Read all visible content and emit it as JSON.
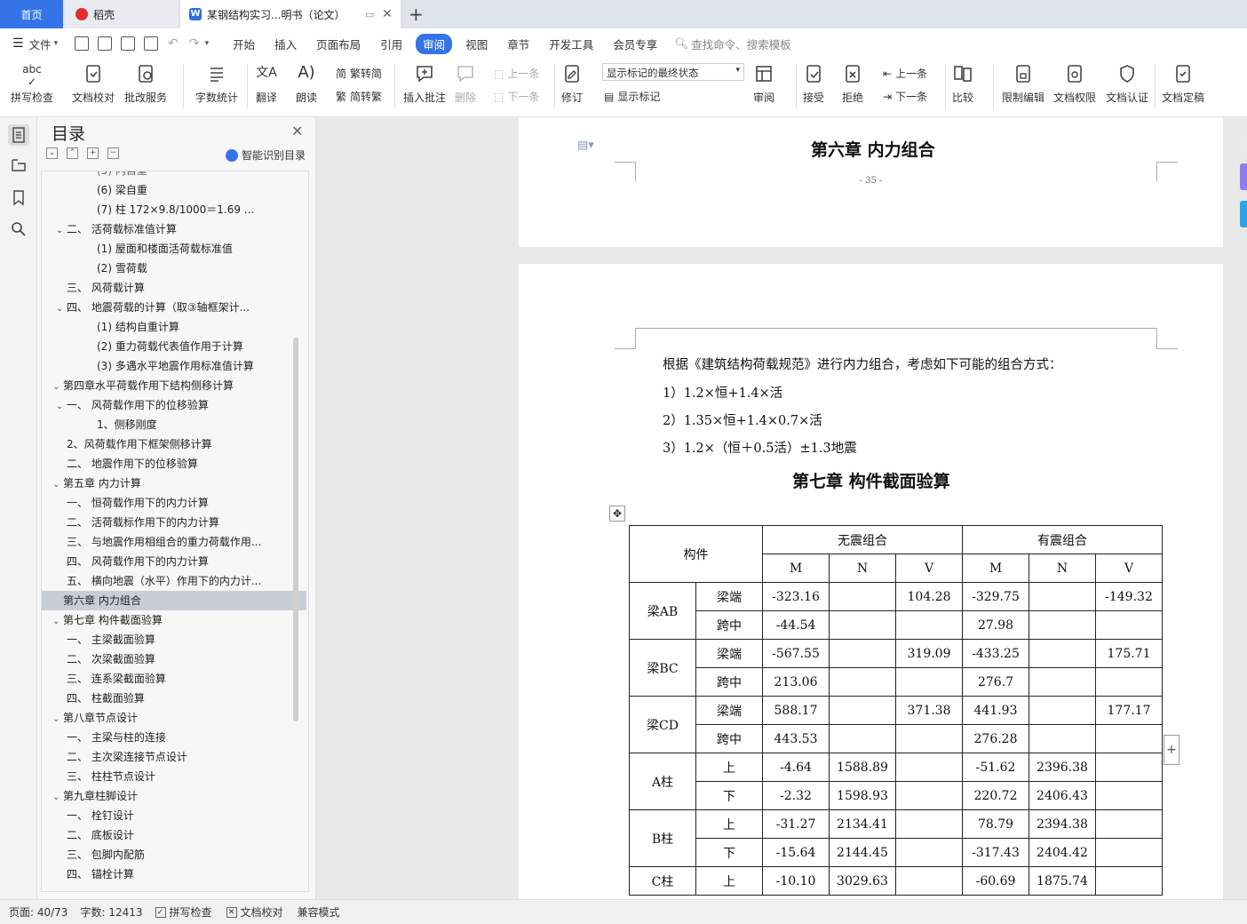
{
  "tabs": {
    "home": "首页",
    "daoke": "稻壳",
    "doc": "某钢结构实习...明书（论文）"
  },
  "menu": {
    "file": "文件",
    "items": [
      "开始",
      "插入",
      "页面布局",
      "引用",
      "审阅",
      "视图",
      "章节",
      "开发工具",
      "会员专享"
    ],
    "active": "审阅",
    "search": "查找命令、搜索模板"
  },
  "toolbar": {
    "spell": "拼写检查",
    "proof": "文档校对",
    "batch": "批改服务",
    "count": "字数统计",
    "translate": "翻译",
    "read": "朗读",
    "t2s": "繁转简",
    "s2t": "简转繁",
    "insert_comment": "插入批注",
    "delete": "删除",
    "prev": "上一条",
    "next": "下一条",
    "revise": "修订",
    "status_select": "显示标记的最终状态",
    "show_marks": "显示标记",
    "review": "审阅",
    "accept": "接受",
    "reject": "拒绝",
    "prev2": "上一条",
    "next2": "下一条",
    "compare": "比较",
    "restrict": "限制编辑",
    "rights": "文档权限",
    "cert": "文档认证",
    "finalize": "文档定稿"
  },
  "toc": {
    "title": "目录",
    "smart": "智能识别目录",
    "items": [
      {
        "text": "(6)  梁自重",
        "indent": 3,
        "caret": ""
      },
      {
        "text": "(7)  柱        172×9.8/1000＝1.69  ...",
        "indent": 3,
        "caret": ""
      },
      {
        "text": "二、     活荷载标准值计算",
        "indent": 2,
        "caret": "v"
      },
      {
        "text": "(1)  屋面和楼面活荷载标准值",
        "indent": 3,
        "caret": ""
      },
      {
        "text": "(2)  雪荷载",
        "indent": 3,
        "caret": ""
      },
      {
        "text": "三、     风荷载计算",
        "indent": 2,
        "caret": ""
      },
      {
        "text": "四、     地震荷载的计算（取③轴框架计...",
        "indent": 2,
        "caret": "v"
      },
      {
        "text": "(1)  结构自重计算",
        "indent": 3,
        "caret": ""
      },
      {
        "text": "(2)  重力荷载代表值作用于计算",
        "indent": 3,
        "caret": ""
      },
      {
        "text": "(3)  多遇水平地震作用标准值计算",
        "indent": 3,
        "caret": ""
      },
      {
        "text": "第四章水平荷载作用下结构侧移计算",
        "indent": 1,
        "caret": "v"
      },
      {
        "text": "一、   风荷载作用下的位移验算",
        "indent": 2,
        "caret": "v"
      },
      {
        "text": "1、侧移刚度",
        "indent": 3,
        "caret": ""
      },
      {
        "text": "2、风荷载作用下框架侧移计算",
        "indent": 2.7,
        "caret": ""
      },
      {
        "text": "二、   地震作用下的位移验算",
        "indent": 2,
        "caret": ""
      },
      {
        "text": "第五章  内力计算",
        "indent": 1,
        "caret": "v"
      },
      {
        "text": "一、   恒荷载作用下的内力计算",
        "indent": 2,
        "caret": ""
      },
      {
        "text": "二、   活荷载标作用下的内力计算",
        "indent": 2,
        "caret": ""
      },
      {
        "text": "三、   与地震作用相组合的重力荷载作用...",
        "indent": 2,
        "caret": ""
      },
      {
        "text": "四、   风荷载作用下的内力计算",
        "indent": 2,
        "caret": ""
      },
      {
        "text": "五、   横向地震（水平）作用下的内力计...",
        "indent": 2,
        "caret": ""
      },
      {
        "text": "第六章  内力组合",
        "indent": 1,
        "caret": "",
        "selected": true
      },
      {
        "text": "第七章  构件截面验算",
        "indent": 1,
        "caret": "v"
      },
      {
        "text": "一、   主梁截面验算",
        "indent": 2,
        "caret": ""
      },
      {
        "text": "二、   次梁截面验算",
        "indent": 2,
        "caret": ""
      },
      {
        "text": "三、   连系梁截面验算",
        "indent": 2,
        "caret": ""
      },
      {
        "text": "四、   柱截面验算",
        "indent": 2,
        "caret": ""
      },
      {
        "text": "第八章节点设计",
        "indent": 1,
        "caret": "v"
      },
      {
        "text": "一、   主梁与柱的连接",
        "indent": 2,
        "caret": ""
      },
      {
        "text": "二、   主次梁连接节点设计",
        "indent": 2,
        "caret": ""
      },
      {
        "text": "三、   柱柱节点设计",
        "indent": 2,
        "caret": ""
      },
      {
        "text": "第九章柱脚设计",
        "indent": 1,
        "caret": "v"
      },
      {
        "text": "一、   栓钉设计",
        "indent": 2,
        "caret": ""
      },
      {
        "text": "二、   底板设计",
        "indent": 2,
        "caret": ""
      },
      {
        "text": "三、   包脚内配筋",
        "indent": 2,
        "caret": ""
      },
      {
        "text": "四、   锚栓计算",
        "indent": 2,
        "caret": ""
      }
    ]
  },
  "doc": {
    "page1_heading": "第六章     内力组合",
    "page_number": "- 35 -",
    "intro": "根据《建筑结构荷载规范》进行内力组合，考虑如下可能的组合方式：",
    "combos": [
      "1）1.2×恒+1.4×活",
      "2）1.35×恒+1.4×0.7×活",
      "3）1.2×（恒＋0.5活）±1.3地震"
    ],
    "chapter7": "第七章     构件截面验算",
    "table": {
      "col_member": "构件",
      "group1": "无震组合",
      "group2": "有震组合",
      "sub": [
        "M",
        "N",
        "V",
        "M",
        "N",
        "V"
      ],
      "groups": [
        {
          "name": "梁AB",
          "rows": [
            {
              "pos": "梁端",
              "v": [
                "-323.16",
                "",
                "104.28",
                "-329.75",
                "",
                "-149.32"
              ]
            },
            {
              "pos": "跨中",
              "v": [
                "-44.54",
                "",
                "",
                "27.98",
                "",
                ""
              ]
            }
          ]
        },
        {
          "name": "梁BC",
          "rows": [
            {
              "pos": "梁端",
              "v": [
                "-567.55",
                "",
                "319.09",
                "-433.25",
                "",
                "175.71"
              ]
            },
            {
              "pos": "跨中",
              "v": [
                "213.06",
                "",
                "",
                "276.7",
                "",
                ""
              ]
            }
          ]
        },
        {
          "name": "梁CD",
          "rows": [
            {
              "pos": "梁端",
              "v": [
                "588.17",
                "",
                "371.38",
                "441.93",
                "",
                "177.17"
              ]
            },
            {
              "pos": "跨中",
              "v": [
                "443.53",
                "",
                "",
                "276.28",
                "",
                ""
              ]
            }
          ]
        },
        {
          "name": "A柱",
          "rows": [
            {
              "pos": "上",
              "v": [
                "-4.64",
                "1588.89",
                "",
                "-51.62",
                "2396.38",
                ""
              ]
            },
            {
              "pos": "下",
              "v": [
                "-2.32",
                "1598.93",
                "",
                "220.72",
                "2406.43",
                ""
              ]
            }
          ]
        },
        {
          "name": "B柱",
          "rows": [
            {
              "pos": "上",
              "v": [
                "-31.27",
                "2134.41",
                "",
                "78.79",
                "2394.38",
                ""
              ]
            },
            {
              "pos": "下",
              "v": [
                "-15.64",
                "2144.45",
                "",
                "-317.43",
                "2404.42",
                ""
              ]
            }
          ]
        },
        {
          "name": "C柱",
          "rows": [
            {
              "pos": "上",
              "v": [
                "-10.10",
                "3029.63",
                "",
                "-60.69",
                "1875.74",
                ""
              ]
            }
          ]
        }
      ]
    }
  },
  "status": {
    "page": "页面: 40/73",
    "words": "字数: 12413",
    "spell": "拼写检查",
    "proof": "文档校对",
    "compat": "兼容模式"
  }
}
